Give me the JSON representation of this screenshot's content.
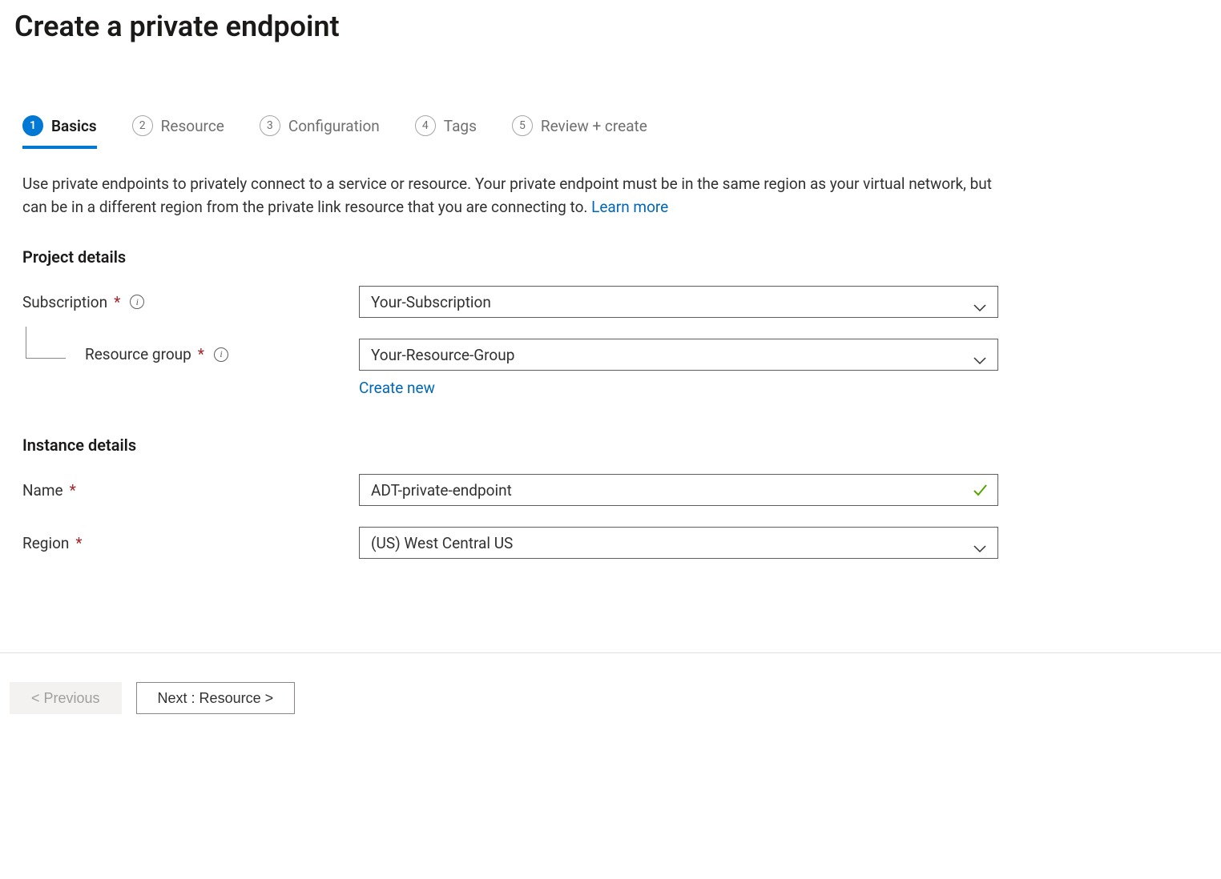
{
  "page_title": "Create a private endpoint",
  "tabs": [
    {
      "num": "1",
      "label": "Basics"
    },
    {
      "num": "2",
      "label": "Resource"
    },
    {
      "num": "3",
      "label": "Configuration"
    },
    {
      "num": "4",
      "label": "Tags"
    },
    {
      "num": "5",
      "label": "Review + create"
    }
  ],
  "description_text": "Use private endpoints to privately connect to a service or resource. Your private endpoint must be in the same region as your virtual network, but can be in a different region from the private link resource that you are connecting to.  ",
  "learn_more_label": "Learn more",
  "sections": {
    "project": {
      "heading": "Project details",
      "subscription_label": "Subscription",
      "subscription_value": "Your-Subscription",
      "resource_group_label": "Resource group",
      "resource_group_value": "Your-Resource-Group",
      "create_new_label": "Create new"
    },
    "instance": {
      "heading": "Instance details",
      "name_label": "Name",
      "name_value": "ADT-private-endpoint",
      "region_label": "Region",
      "region_value": "(US) West Central US"
    }
  },
  "footer": {
    "previous_label": "< Previous",
    "next_label": "Next : Resource >"
  }
}
